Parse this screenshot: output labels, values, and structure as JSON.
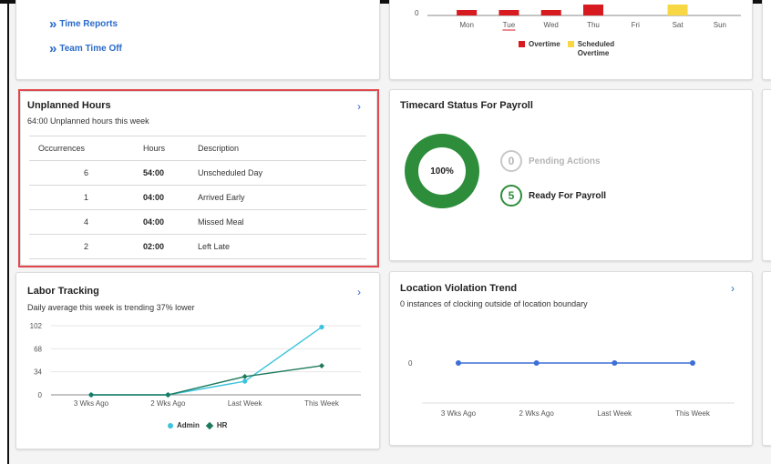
{
  "quick_links": [
    "Time Reports",
    "Team Time Off"
  ],
  "top_chart": {
    "zero_label": "0",
    "days": [
      "Mon",
      "Tue",
      "Wed",
      "Thu",
      "Fri",
      "Sat",
      "Sun"
    ],
    "legend": [
      "Overtime",
      "Scheduled Overtime"
    ],
    "colors": {
      "overtime": "#d71920",
      "scheduled_overtime": "#f7d844"
    }
  },
  "unplanned": {
    "title": "Unplanned Hours",
    "subtitle": "64:00 Unplanned hours this week",
    "columns": [
      "Occurrences",
      "Hours",
      "Description"
    ],
    "rows": [
      {
        "occurrences": "6",
        "hours": "54:00",
        "description": "Unscheduled Day"
      },
      {
        "occurrences": "1",
        "hours": "04:00",
        "description": "Arrived Early"
      },
      {
        "occurrences": "4",
        "hours": "04:00",
        "description": "Missed Meal"
      },
      {
        "occurrences": "2",
        "hours": "02:00",
        "description": "Left Late"
      }
    ]
  },
  "timecard": {
    "title": "Timecard Status For Payroll",
    "percent": "100%",
    "pending_count": "0",
    "pending_label": "Pending Actions",
    "ready_count": "5",
    "ready_label": "Ready For Payroll",
    "colors": {
      "ring": "#2d8d3b"
    }
  },
  "labor": {
    "title": "Labor Tracking",
    "subtitle": "Daily average this week is trending 37% lower",
    "y_ticks": [
      "102",
      "68",
      "34",
      "0"
    ],
    "x_labels": [
      "3 Wks Ago",
      "2 Wks Ago",
      "Last Week",
      "This Week"
    ],
    "legend": [
      "Admin",
      "HR"
    ],
    "colors": {
      "admin": "#3cc3dd",
      "hr": "#1e7a5e"
    }
  },
  "location": {
    "title": "Location Violation Trend",
    "subtitle": "0 instances of clocking outside of location boundary",
    "y_tick": "0",
    "x_labels": [
      "3 Wks Ago",
      "2 Wks Ago",
      "Last Week",
      "This Week"
    ],
    "colors": {
      "line": "#3d6fd6"
    }
  },
  "chart_data": [
    {
      "type": "bar",
      "categories": [
        "Mon",
        "Tue",
        "Wed",
        "Thu",
        "Fri",
        "Sat",
        "Sun"
      ],
      "series": [
        {
          "name": "Overtime",
          "values": [
            1,
            1,
            1,
            2,
            0,
            0,
            0
          ]
        },
        {
          "name": "Scheduled Overtime",
          "values": [
            0,
            0,
            0,
            0,
            0,
            2,
            0
          ]
        }
      ]
    },
    {
      "type": "line",
      "title": "Labor Tracking",
      "categories": [
        "3 Wks Ago",
        "2 Wks Ago",
        "Last Week",
        "This Week"
      ],
      "series": [
        {
          "name": "Admin",
          "values": [
            0,
            0,
            20,
            100
          ]
        },
        {
          "name": "HR",
          "values": [
            0,
            0,
            27,
            43
          ]
        }
      ],
      "ylim": [
        0,
        102
      ]
    },
    {
      "type": "line",
      "title": "Location Violation Trend",
      "categories": [
        "3 Wks Ago",
        "2 Wks Ago",
        "Last Week",
        "This Week"
      ],
      "series": [
        {
          "values": [
            0,
            0,
            0,
            0
          ]
        }
      ]
    }
  ]
}
